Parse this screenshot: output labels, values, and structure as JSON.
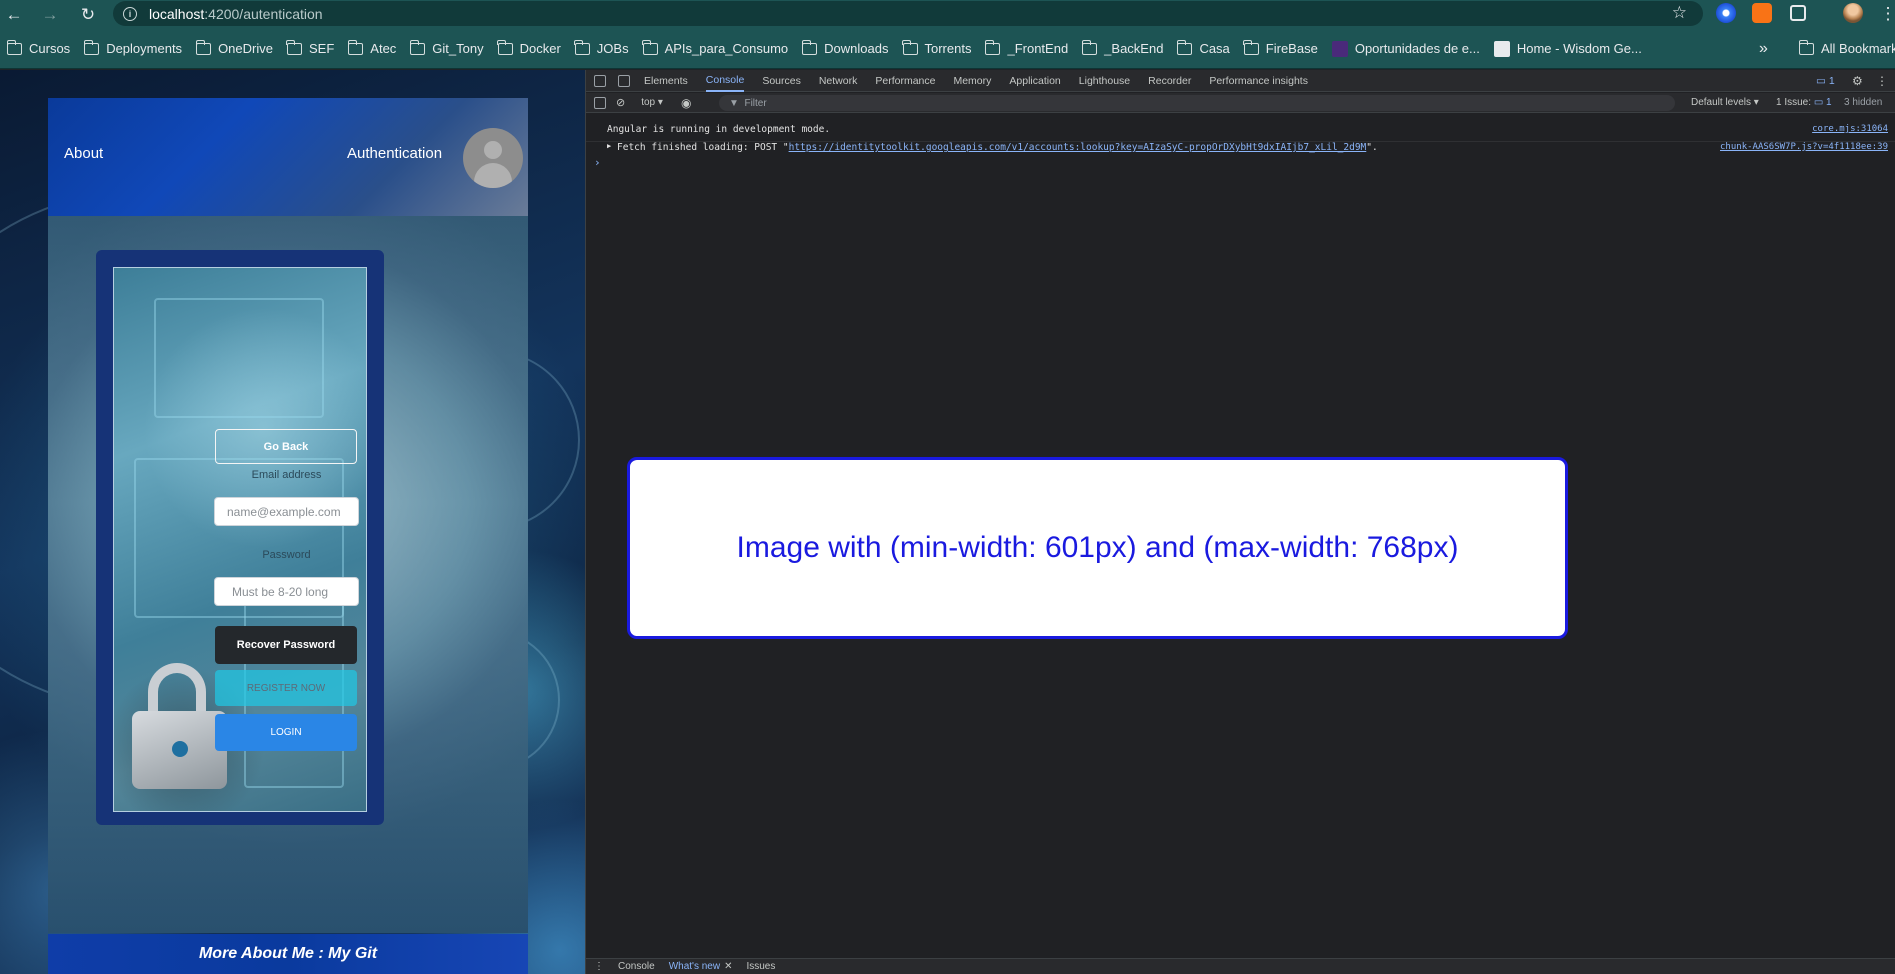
{
  "browser": {
    "url_host": "localhost",
    "url_path": ":4200/autentication",
    "bookmarks": [
      "Cursos",
      "Deployments",
      "OneDrive",
      "SEF",
      "Atec",
      "Git_Tony",
      "Docker",
      "JOBs",
      "APIs_para_Consumo",
      "Downloads",
      "Torrents",
      "_FrontEnd",
      "_BackEnd",
      "Casa",
      "FireBase",
      "Oportunidades de e...",
      "Home - Wisdom Ge..."
    ],
    "more_bookmarks": "»",
    "all_bookmarks": "All Bookmarks"
  },
  "app": {
    "nav_about": "About",
    "nav_authentication": "Authentication",
    "go_back": "Go Back",
    "email_label": "Email address",
    "email_placeholder": "name@example.com",
    "password_label": "Password",
    "password_placeholder": "Must be 8-20  long",
    "recover_password": "Recover Password",
    "register_now": "REGISTER NOW",
    "login": "LOGIN",
    "footer": "More About Me : My Git"
  },
  "devtools": {
    "tabs": [
      "Elements",
      "Console",
      "Sources",
      "Network",
      "Performance",
      "Memory",
      "Application",
      "Lighthouse",
      "Recorder",
      "Performance insights"
    ],
    "active_tab": "Console",
    "issues_badge": "1",
    "context": "top",
    "filter_placeholder": "Filter",
    "levels": "Default levels",
    "issue_count": "1 Issue:",
    "issue_num": "1",
    "hidden": "3 hidden",
    "log1_text": "Angular is running in development mode.",
    "log1_src": "core.mjs:31064",
    "log2_prefix": "Fetch finished loading: POST \"",
    "log2_url": "https://identitytoolkit.googleapis.com/v1/accounts:lookup?key=AIzaSyC-propOrDXybHt9dxIAIjb7_xLil_2d9M",
    "log2_suffix": "\".",
    "log2_src": "chunk-AAS6SW7P.js?v=4f1118ee:39",
    "media_text": "Image with (min-width: 601px) and (max-width: 768px)",
    "drawer_tabs": [
      "Console",
      "What's new",
      "Issues"
    ]
  }
}
